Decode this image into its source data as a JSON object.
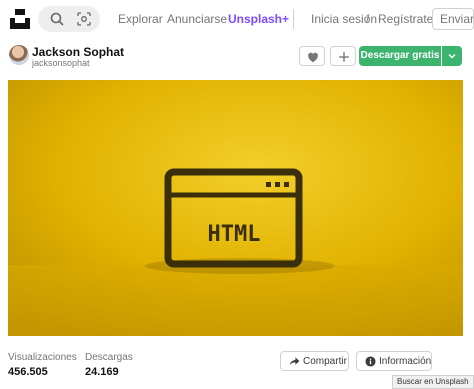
{
  "header": {
    "search_icon": "search-icon",
    "visual_search_icon": "visual-search-icon",
    "nav": {
      "explore": "Explorar",
      "advertise": "Anunciarse",
      "plus": "Unsplash+",
      "login": "Inicia sesión",
      "separator": "/",
      "register": "Regístrate",
      "submit": "Enviar"
    },
    "colors": {
      "plus_accent": "#7c4dff"
    }
  },
  "author": {
    "name": "Jackson Sophat",
    "handle": "jacksonsophat"
  },
  "actions": {
    "like_icon": "heart-icon",
    "add_icon": "plus-icon",
    "download_label": "Descargar gratis",
    "download_color": "#3cb46e",
    "download_caret_icon": "chevron-down-icon"
  },
  "photo": {
    "text": "HTML",
    "background_color": "#e0b100"
  },
  "stats": {
    "views_label": "Visualizaciones",
    "views_value": "456.505",
    "downloads_label": "Descargas",
    "downloads_value": "24.169"
  },
  "footer_actions": {
    "share_label": "Compartir",
    "share_icon": "share-arrow-icon",
    "info_label": "Información",
    "info_icon": "info-icon"
  },
  "tooltip": {
    "text": "Buscar en Unsplash"
  }
}
